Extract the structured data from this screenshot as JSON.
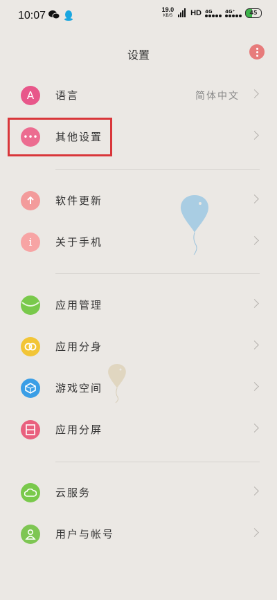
{
  "status_bar": {
    "time": "10:07",
    "speed_value": "19.0",
    "speed_unit": "KB/S",
    "hd": "HD",
    "net1": "4G",
    "net2": "4G⁺",
    "battery": "45"
  },
  "header": {
    "title": "设置"
  },
  "items": [
    {
      "label": "语言",
      "value": "简体中文",
      "icon": "language-icon",
      "color": "#e8578a",
      "glyph": "A"
    },
    {
      "label": "其他设置",
      "icon": "more-dots-icon",
      "color": "#ec6c90",
      "glyph": "···"
    },
    {
      "label": "软件更新",
      "icon": "update-arrow-icon",
      "color": "#f39b9b",
      "glyph": "↑"
    },
    {
      "label": "关于手机",
      "icon": "info-icon",
      "color": "#f7a4a4",
      "glyph": "i"
    },
    {
      "label": "应用管理",
      "icon": "app-manage-icon",
      "color": "#79c94b",
      "glyph": ""
    },
    {
      "label": "应用分身",
      "icon": "app-clone-icon",
      "color": "#f2c536",
      "glyph": "∞"
    },
    {
      "label": "游戏空间",
      "icon": "game-space-icon",
      "color": "#3a9ee6",
      "glyph": "⬡"
    },
    {
      "label": "应用分屏",
      "icon": "split-screen-icon",
      "color": "#e9607e",
      "glyph": "◫"
    },
    {
      "label": "云服务",
      "icon": "cloud-icon",
      "color": "#79c94b",
      "glyph": "☁"
    },
    {
      "label": "用户与帐号",
      "icon": "user-icon",
      "color": "#7ec653",
      "glyph": "👤"
    }
  ]
}
